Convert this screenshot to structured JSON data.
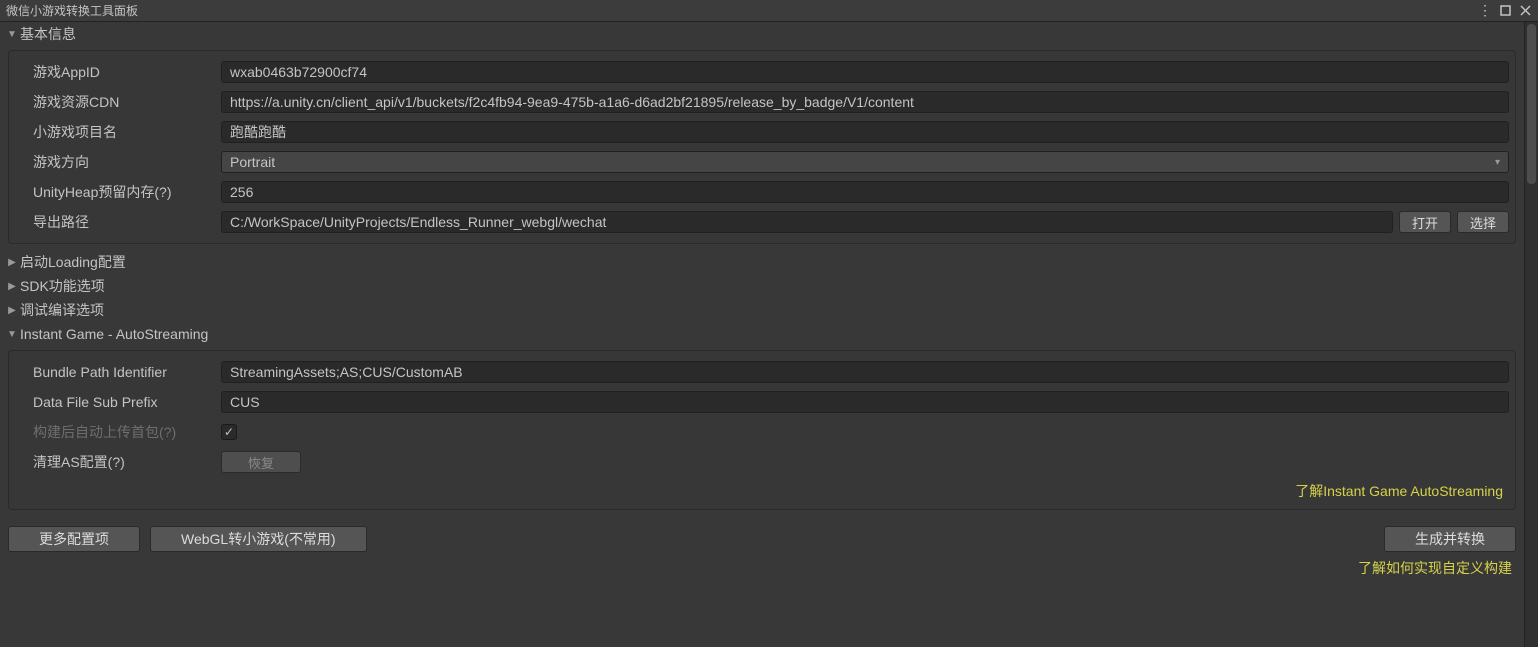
{
  "window": {
    "title": "微信小游戏转换工具面板"
  },
  "sections": {
    "basic": {
      "title": "基本信息",
      "fields": {
        "appid_label": "游戏AppID",
        "appid_value": "wxab0463b72900cf74",
        "cdn_label": "游戏资源CDN",
        "cdn_value": "https://a.unity.cn/client_api/v1/buckets/f2c4fb94-9ea9-475b-a1a6-d6ad2bf21895/release_by_badge/V1/content",
        "project_name_label": "小游戏项目名",
        "project_name_value": "跑酷跑酷",
        "orientation_label": "游戏方向",
        "orientation_value": "Portrait",
        "heap_label": "UnityHeap预留内存(?)",
        "heap_value": "256",
        "export_path_label": "导出路径",
        "export_path_value": "C:/WorkSpace/UnityProjects/Endless_Runner_webgl/wechat",
        "open_btn": "打开",
        "select_btn": "选择"
      }
    },
    "loading": {
      "title": "启动Loading配置"
    },
    "sdk": {
      "title": "SDK功能选项"
    },
    "debug": {
      "title": "调试编译选项"
    },
    "instant": {
      "title": "Instant Game - AutoStreaming",
      "fields": {
        "bundle_path_label": "Bundle Path Identifier",
        "bundle_path_value": "StreamingAssets;AS;CUS/CustomAB",
        "data_prefix_label": "Data File Sub Prefix",
        "data_prefix_value": "CUS",
        "auto_upload_label": "构建后自动上传首包(?)",
        "auto_upload_checked": true,
        "clean_as_label": "清理AS配置(?)",
        "restore_btn": "恢复",
        "learn_link": "了解Instant Game AutoStreaming"
      }
    }
  },
  "footer": {
    "more_config": "更多配置项",
    "webgl_convert": "WebGL转小游戏(不常用)",
    "generate": "生成并转换",
    "custom_build_link": "了解如何实现自定义构建"
  }
}
